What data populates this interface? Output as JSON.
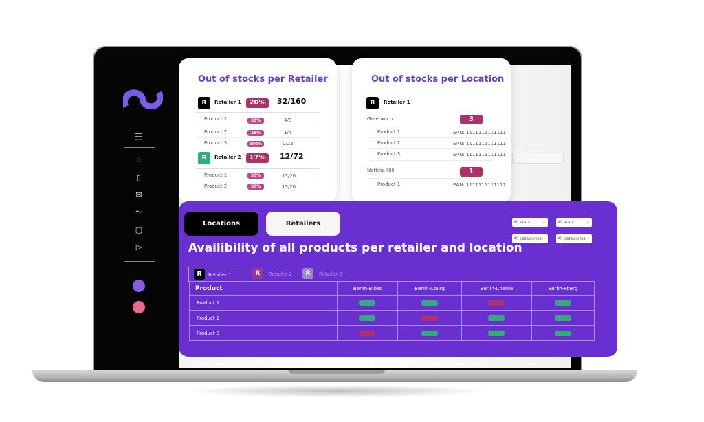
{
  "colors": {
    "accent": "#6b3fd6",
    "panel": "#6a2fd0",
    "bad": "#b0306a",
    "good": "#2fae78"
  },
  "sidebar": {
    "icons": [
      "menu-icon",
      "star-icon",
      "bookmark-icon",
      "mail-icon",
      "chart-line-icon",
      "document-icon",
      "play-icon"
    ]
  },
  "retailer_card": {
    "title": "Out of stocks per Retailer",
    "retailers": [
      {
        "logo": "R",
        "name": "Retailer 1",
        "percent": "20%",
        "ratio": "32/160",
        "products": [
          {
            "name": "Product 1",
            "percent": "50%",
            "ratio": "4/8"
          },
          {
            "name": "Product 2",
            "percent": "25%",
            "ratio": "1/4"
          },
          {
            "name": "Product 3",
            "percent": "100%",
            "ratio": "0/25"
          }
        ]
      },
      {
        "logo": "R",
        "name": "Retailer 2",
        "percent": "17%",
        "ratio": "12/72",
        "products": [
          {
            "name": "Product 1",
            "percent": "50%",
            "ratio": "13/26"
          },
          {
            "name": "Product 2",
            "percent": "50%",
            "ratio": "13/26"
          }
        ]
      }
    ]
  },
  "location_card": {
    "title": "Out of stocks per Location",
    "retailer": {
      "logo": "R",
      "name": "Retailer 1"
    },
    "locations": [
      {
        "name": "Greenwich",
        "count": "3",
        "products": [
          {
            "name": "Product 1",
            "ean": "EAN: 1111111111111"
          },
          {
            "name": "Product 2",
            "ean": "EAN: 1111111111111"
          },
          {
            "name": "Product 3",
            "ean": "EAN: 1111111111111"
          }
        ]
      },
      {
        "name": "Notting Hill",
        "count": "1",
        "products": [
          {
            "name": "Product 1",
            "ean": "EAN: 1111111111111"
          }
        ]
      }
    ]
  },
  "panel": {
    "tabs": [
      {
        "label": "Locations",
        "active": true
      },
      {
        "label": "Retailers",
        "active": false
      }
    ],
    "filters": [
      "All stats",
      "All stats",
      "All categories",
      "All categories"
    ],
    "title": "Availibility of all products per retailer and location",
    "retailer_tabs": [
      {
        "logo": "R",
        "label": "Retailer 1",
        "active": true
      },
      {
        "logo": "R",
        "label": "Retailer 2"
      },
      {
        "logo": "R",
        "label": "Retailer 3"
      }
    ],
    "table": {
      "headers": [
        "Product",
        "Berlin-Bikez",
        "Berlin-Cburg",
        "Berlin-Charlie",
        "Berlin-Fberg"
      ],
      "rows": [
        {
          "product": "Product 1",
          "status": [
            "in-stock",
            "in-stock",
            "out-of-stock",
            "in-stock"
          ]
        },
        {
          "product": "Product 2",
          "status": [
            "in-stock",
            "out-of-stock",
            "in-stock",
            "in-stock"
          ]
        },
        {
          "product": "Product 3",
          "status": [
            "out-of-stock",
            "in-stock",
            "in-stock",
            "in-stock"
          ]
        }
      ]
    }
  }
}
